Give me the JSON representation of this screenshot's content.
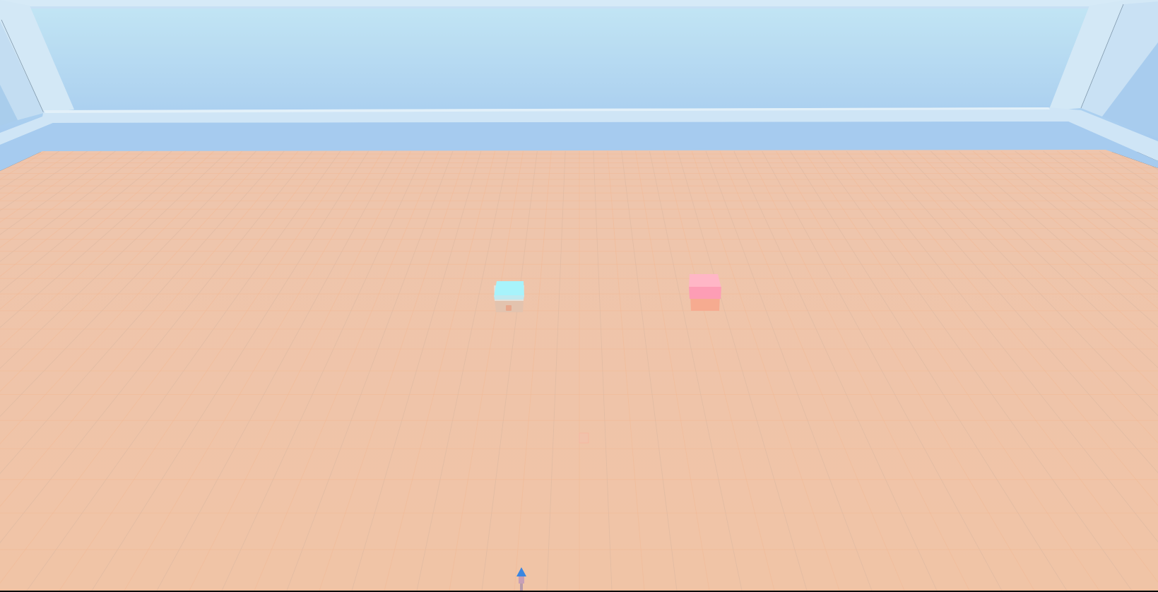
{
  "scene": {
    "description_free": true,
    "colors": {
      "sky_top": "#bfe3f3",
      "sky_bottom": "#a4c9ee",
      "far_wall": "#a6cbef",
      "frame_light": "#d5e9f6",
      "frame_mid": "#c4def4",
      "frame_edge": "#9fbfdc",
      "floor": "#efc6ab",
      "floor_grid": "#f3b894",
      "floor_grid_dark": "#d9b6a0",
      "cube_cyan_top": "#a7f6fb",
      "cube_cyan_side": "#8fe8f3",
      "cube_pink_top": "#ffb3c4",
      "cube_pink_side": "#fd9db4",
      "shadow": "#e7b79c",
      "marker_blue": "#3a86e0",
      "marker_stem": "#c7a0b8"
    },
    "objects": [
      {
        "name": "cyan-cube",
        "color": "cyan"
      },
      {
        "name": "pink-cube",
        "color": "pink"
      },
      {
        "name": "faint-floor-tile",
        "color": "floor"
      },
      {
        "name": "player-marker",
        "color": "blue"
      }
    ]
  }
}
